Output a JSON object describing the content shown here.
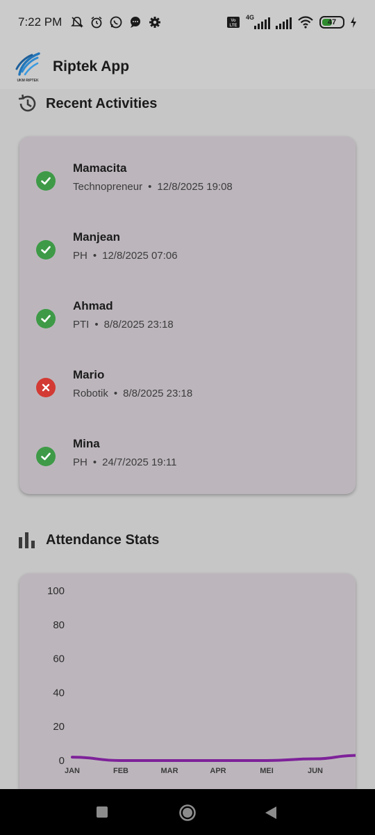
{
  "status_bar": {
    "time": "7:22 PM",
    "battery_level": "47",
    "network": "4G"
  },
  "app_bar": {
    "logo_text": "UKM RIPTEK",
    "title": "Riptek App"
  },
  "recent_activities": {
    "title": "Recent Activities",
    "items": [
      {
        "name": "Mamacita",
        "division": "Technopreneur",
        "datetime": "12/8/2025 19:08",
        "status": "success"
      },
      {
        "name": "Manjean",
        "division": "PH",
        "datetime": "12/8/2025 07:06",
        "status": "success"
      },
      {
        "name": "Ahmad",
        "division": "PTI",
        "datetime": "8/8/2025 23:18",
        "status": "success"
      },
      {
        "name": "Mario",
        "division": "Robotik",
        "datetime": "8/8/2025 23:18",
        "status": "failed"
      },
      {
        "name": "Mina",
        "division": "PH",
        "datetime": "24/7/2025 19:11",
        "status": "success"
      }
    ],
    "separator": "•"
  },
  "attendance_stats": {
    "title": "Attendance Stats"
  },
  "colors": {
    "success": "#3e9a47",
    "failed": "#d33a34",
    "line": "#7e2299",
    "card": "#bcb6bc",
    "background": "#c6c6c6"
  },
  "chart_data": {
    "type": "line",
    "categories": [
      "JAN",
      "FEB",
      "MAR",
      "APR",
      "MEI",
      "JUN"
    ],
    "series": [
      {
        "values": [
          2,
          0,
          0,
          0,
          0,
          1
        ]
      }
    ],
    "y_ticks": [
      "100",
      "80",
      "60",
      "40",
      "20",
      "0"
    ],
    "ylim": [
      0,
      100
    ],
    "grid": false
  }
}
